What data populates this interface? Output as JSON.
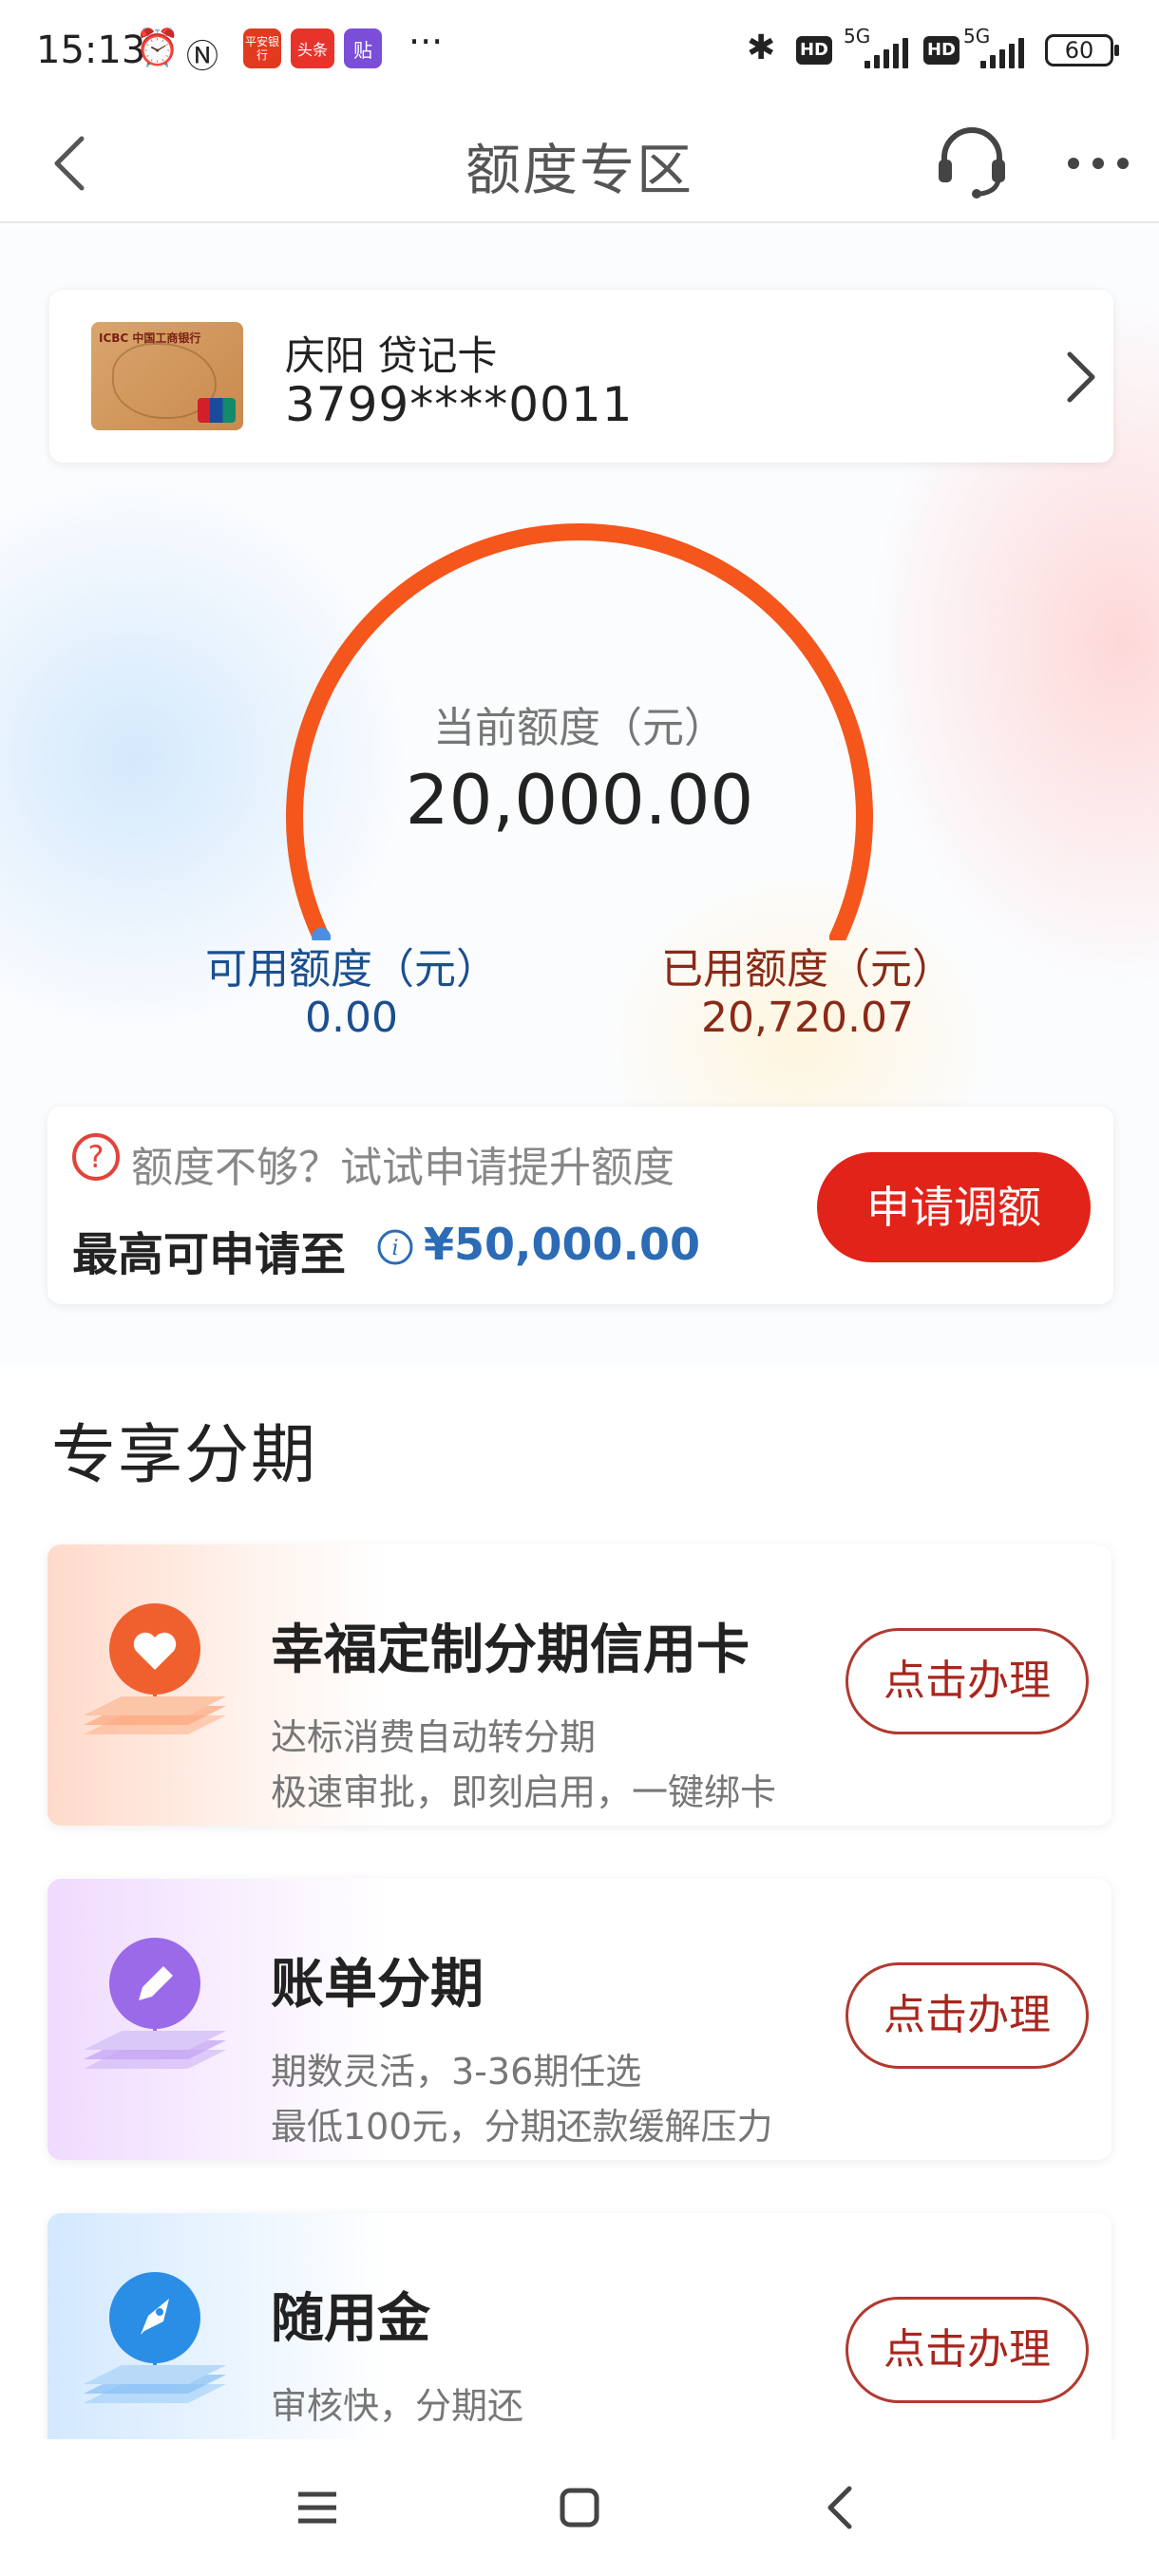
{
  "status_bar": {
    "time": "15:13",
    "app_badges": [
      "平安银行",
      "头条",
      "贴"
    ],
    "more": "···",
    "network_1": "5G",
    "network_2": "5G",
    "hd": "HD",
    "battery": "60"
  },
  "header": {
    "title": "额度专区"
  },
  "card": {
    "name": "庆阳 贷记卡",
    "number": "3799****0011",
    "thumb_bank_text": "ICBC 中国工商银行"
  },
  "limit": {
    "label": "当前额度（元）",
    "value": "20,000.00",
    "available_label": "可用额度（元）",
    "available_value": "0.00",
    "used_label": "已用额度（元）",
    "used_value": "20,720.07",
    "arc_fill_fraction": 1.0
  },
  "raise": {
    "hint": "额度不够？试试申请提升额度",
    "max_label": "最高可申请至",
    "max_value": "¥50,000.00",
    "button": "申请调额"
  },
  "section": {
    "title": "专享分期"
  },
  "products": [
    {
      "title": "幸福定制分期信用卡",
      "line1": "达标消费自动转分期",
      "line2": "极速审批，即刻启用，一键绑卡",
      "button": "点击办理",
      "icon": "heart-icon",
      "color": "#f0602f"
    },
    {
      "title": "账单分期",
      "line1": "期数灵活，3-36期任选",
      "line2": "最低100元，分期还款缓解压力",
      "button": "点击办理",
      "icon": "pencil-icon",
      "color": "#9a6ae8"
    },
    {
      "title": "随用金",
      "line1": "审核快，分期还",
      "line2": "",
      "button": "点击办理",
      "icon": "rocket-icon",
      "color": "#2a8ee6"
    }
  ],
  "colors": {
    "accent_red": "#e2231a",
    "gauge_orange": "#f5561c",
    "available_blue": "#1b4f8f",
    "used_brown": "#8a2a18",
    "max_value_blue": "#2c6bb5"
  }
}
